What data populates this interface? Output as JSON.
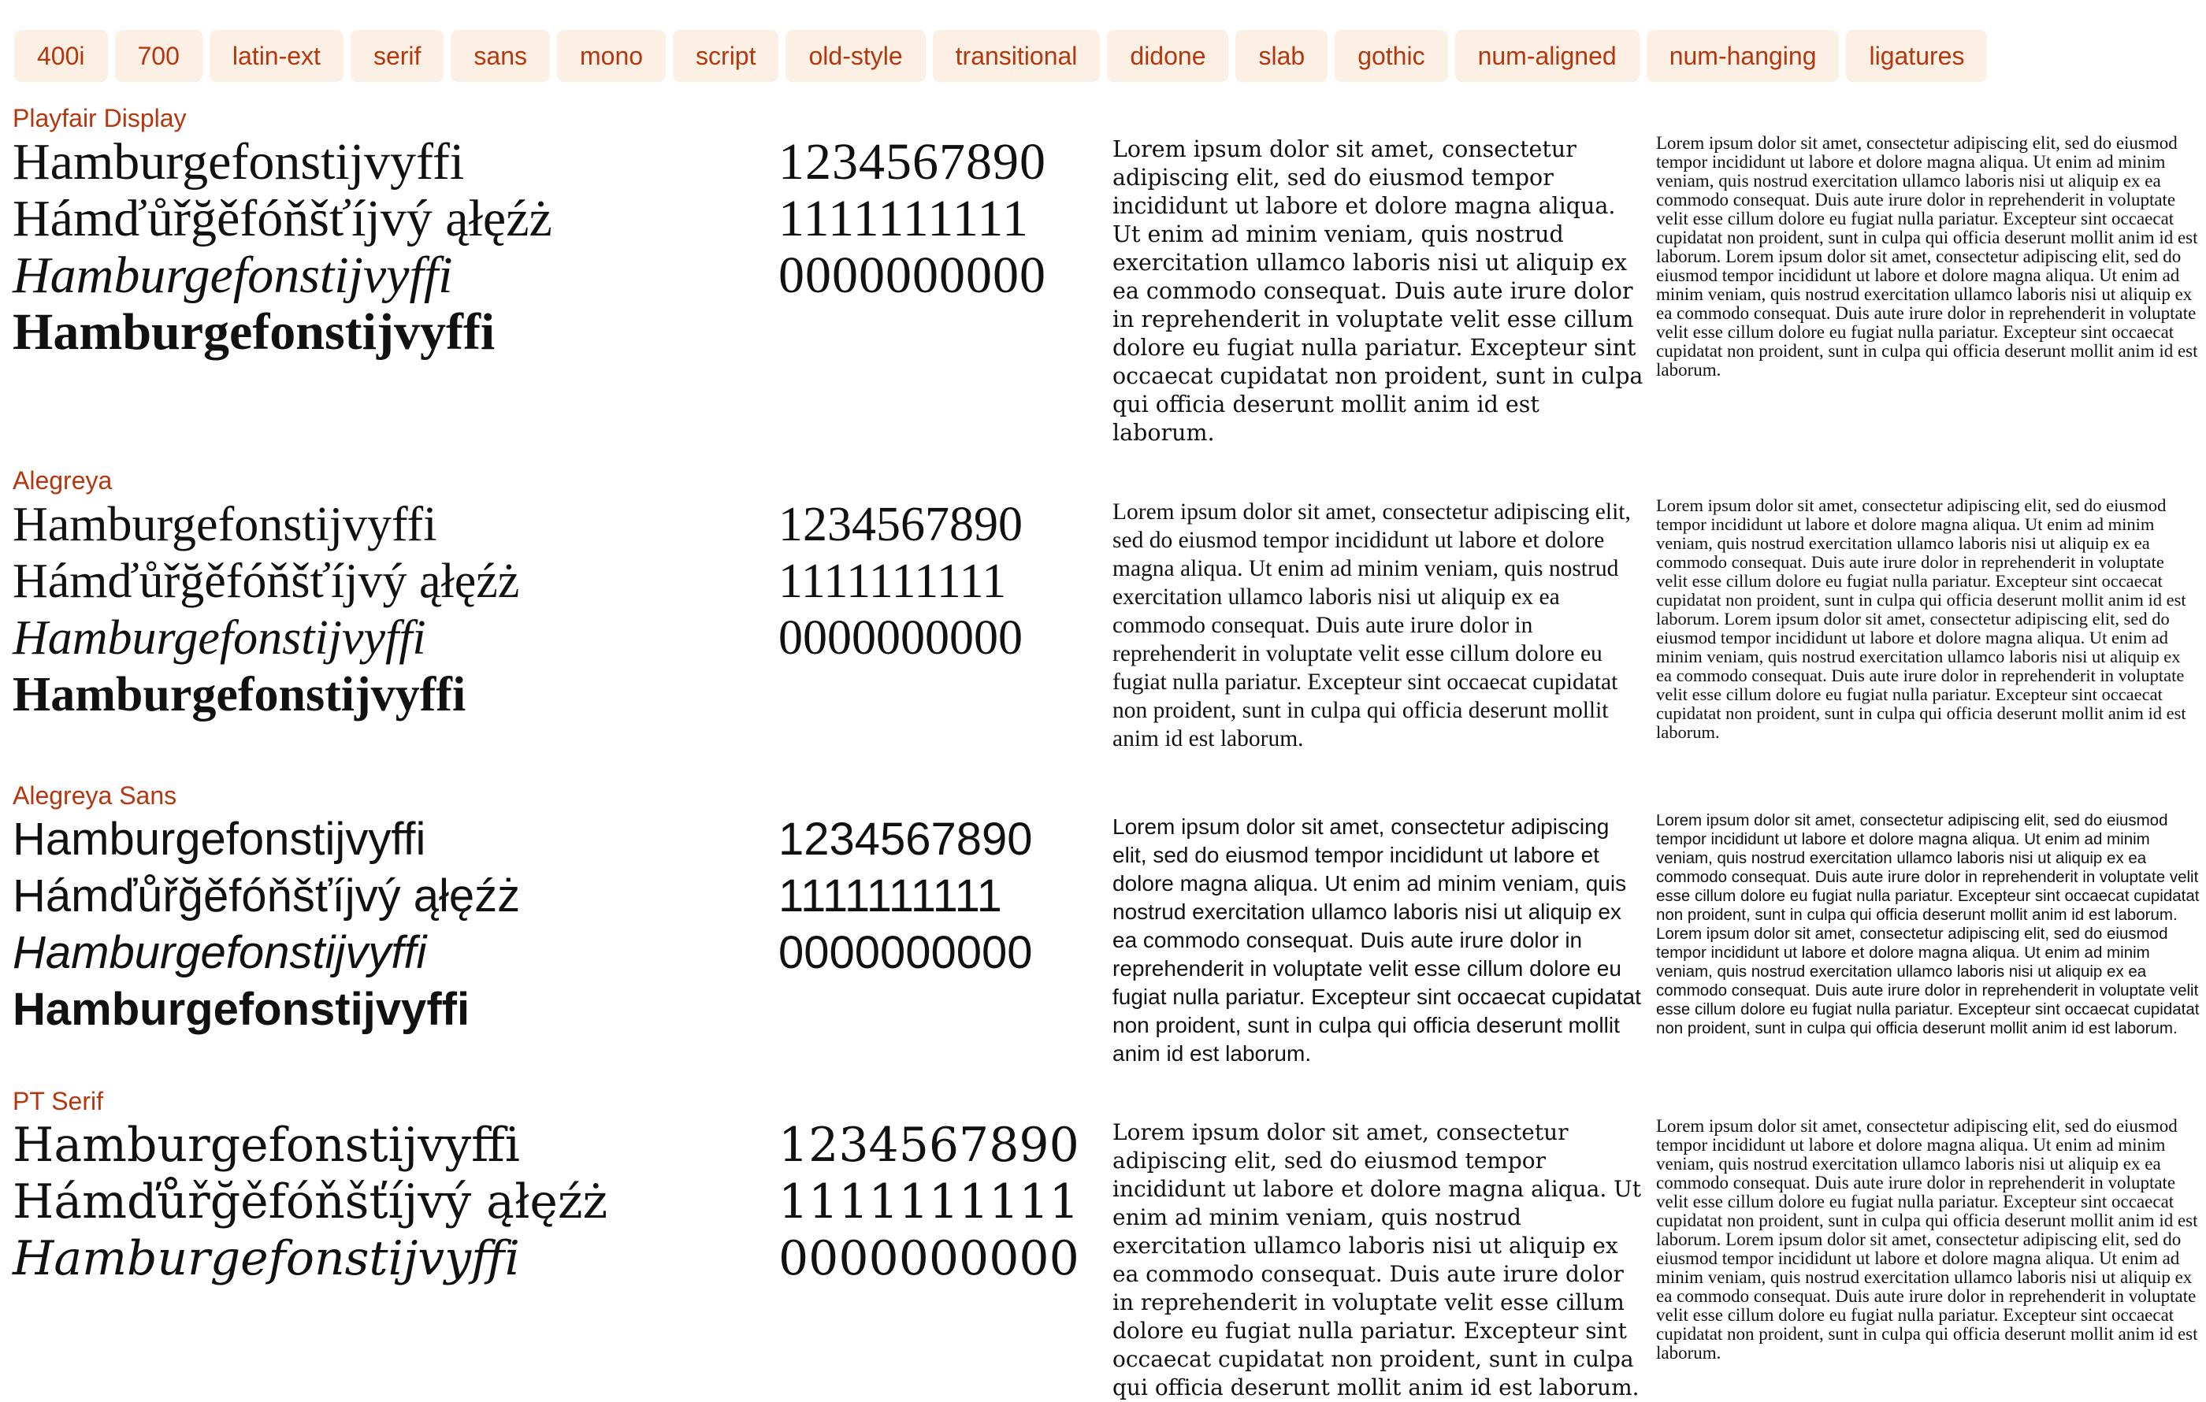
{
  "tags": [
    "400i",
    "700",
    "latin-ext",
    "serif",
    "sans",
    "mono",
    "script",
    "old-style",
    "transitional",
    "didone",
    "slab",
    "gothic",
    "num-aligned",
    "num-hanging",
    "ligatures"
  ],
  "colors": {
    "accent": "#b5370d",
    "tag_bg": "#fcefe4",
    "text": "#111111"
  },
  "sample": {
    "regular": "Hamburgefonstijvyffi",
    "extended": "Hámďůřğěfóňšťíjvý ąłęźż",
    "italic": "Hamburgefonstijvyffi",
    "bold": "Hamburgefonstijvyffi",
    "digits": "1234567890",
    "ones": "1111111111",
    "zeros": "0000000000",
    "lorem": "Lorem ipsum dolor sit amet, consectetur adipiscing elit, sed do eiusmod tempor incididunt ut labore et dolore magna aliqua. Ut enim ad minim veniam, quis nostrud exercitation ullamco laboris nisi ut aliquip ex ea commodo consequat. Duis aute irure dolor in reprehenderit in voluptate velit esse cillum dolore eu fugiat nulla pariatur. Excepteur sint occaecat cupidatat non proident, sunt in culpa qui officia deserunt mollit anim id est laborum.",
    "lorem_double": "Lorem ipsum dolor sit amet, consectetur adipiscing elit, sed do eiusmod tempor incididunt ut labore et dolore magna aliqua. Ut enim ad minim veniam, quis nostrud exercitation ullamco laboris nisi ut aliquip ex ea commodo consequat. Duis aute irure dolor in reprehenderit in voluptate velit esse cillum dolore eu fugiat nulla pariatur. Excepteur sint occaecat cupidatat non proident, sunt in culpa qui officia deserunt mollit anim id est laborum. Lorem ipsum dolor sit amet, consectetur adipiscing elit, sed do eiusmod tempor incididunt ut labore et dolore magna aliqua. Ut enim ad minim veniam, quis nostrud exercitation ullamco laboris nisi ut aliquip ex ea commodo consequat. Duis aute irure dolor in reprehenderit in voluptate velit esse cillum dolore eu fugiat nulla pariatur. Excepteur sint occaecat cupidatat non proident, sunt in culpa qui officia deserunt mollit anim id est laborum."
  },
  "fonts": [
    {
      "name": "Playfair Display"
    },
    {
      "name": "Alegreya"
    },
    {
      "name": "Alegreya Sans"
    },
    {
      "name": "PT Serif"
    }
  ]
}
